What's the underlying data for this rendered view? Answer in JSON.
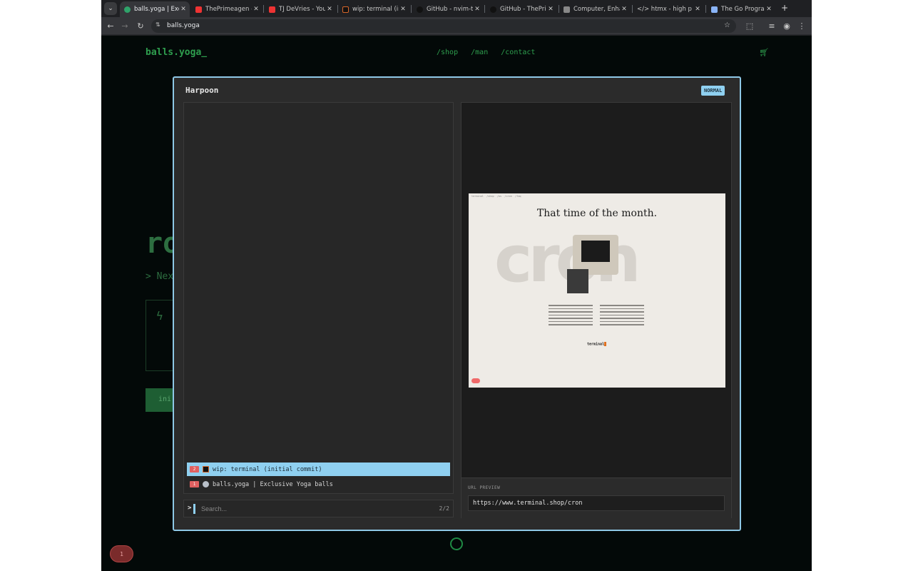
{
  "browser": {
    "tabs": [
      {
        "title": "balls.yoga | Exclu",
        "favicon": "green-globe",
        "active": true
      },
      {
        "title": "ThePrimeagen - Y",
        "favicon": "youtube"
      },
      {
        "title": "TJ DeVries - YouTu",
        "favicon": "youtube"
      },
      {
        "title": "wip: terminal (ini",
        "favicon": "terminal"
      },
      {
        "title": "GitHub - nvim-tel",
        "favicon": "github"
      },
      {
        "title": "GitHub - ThePrim",
        "favicon": "github"
      },
      {
        "title": "Computer, Enhan",
        "favicon": "puzzle"
      },
      {
        "title": "</> htmx - high p",
        "favicon": "htmx"
      },
      {
        "title": "The Go Programm",
        "favicon": "doc"
      }
    ],
    "address": "balls.yoga"
  },
  "site": {
    "logo": "balls.yoga_",
    "nav": [
      "/shop",
      "/man",
      "/contact"
    ],
    "hero_fragment": "ro",
    "hero_sub": "> Nex",
    "cta_fragment": "ini",
    "count_badge": "1"
  },
  "harpoon": {
    "title": "Harpoon",
    "mode": "NORMAL",
    "items": [
      {
        "index": "2",
        "label": "wip: terminal (initial commit)",
        "selected": true
      },
      {
        "index": "1",
        "label": "balls.yoga | Exclusive Yoga balls",
        "selected": false
      }
    ],
    "search": {
      "prompt": ">",
      "placeholder": "Search...",
      "count": "2/2"
    },
    "preview": {
      "headline": "That time of the month.",
      "big_word": "cron",
      "brand": "terminal",
      "url_label": "URL PREVIEW",
      "url": "https://www.terminal.shop/cron"
    }
  },
  "colors": {
    "accent": "#8fd0f0",
    "site_green": "#2e9e4e",
    "badge_red": "#e06060"
  }
}
